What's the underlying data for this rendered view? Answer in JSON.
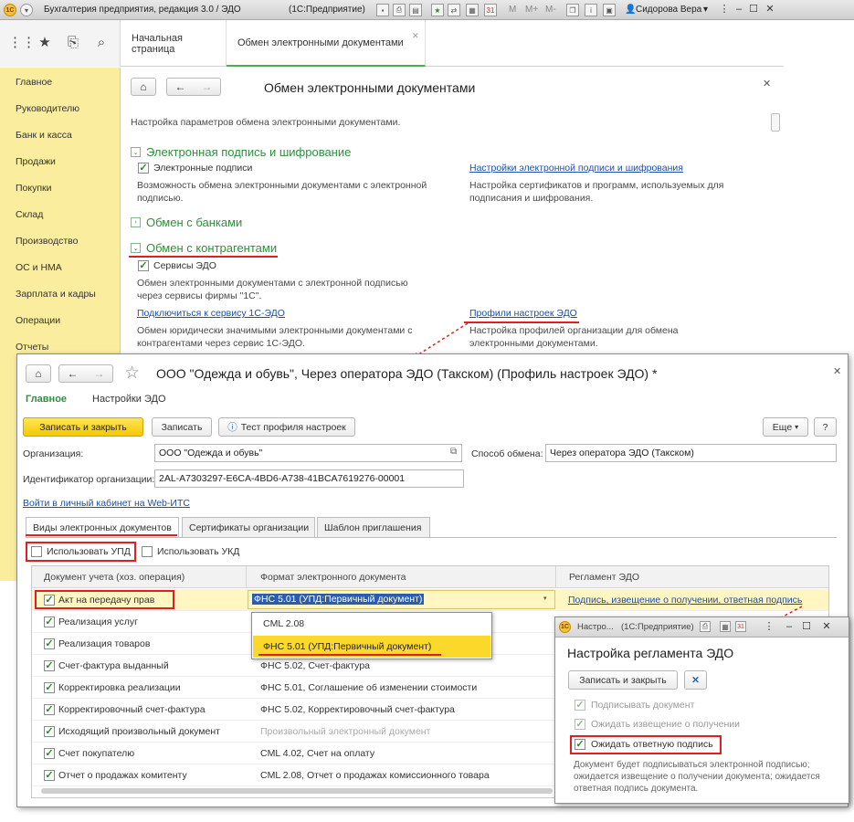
{
  "app": {
    "title": "Бухгалтерия предприятия, редакция 3.0 / ЭДО",
    "platform": "(1С:Предприятие)",
    "toolbar_letters": [
      "M",
      "M+",
      "M-"
    ],
    "user": "Сидорова Вера"
  },
  "tabs": [
    {
      "label": "Начальная страница"
    },
    {
      "label": "Обмен электронными документами"
    }
  ],
  "sidebar": {
    "items": [
      "Главное",
      "Руководителю",
      "Банк и касса",
      "Продажи",
      "Покупки",
      "Склад",
      "Производство",
      "ОС и НМА",
      "Зарплата и кадры",
      "Операции",
      "Отчеты"
    ]
  },
  "main": {
    "title": "Обмен электронными документами",
    "description": "Настройка параметров обмена электронными документами.",
    "section_signature": {
      "title": "Электронная подпись и шифрование",
      "checkbox": "Электронные подписи",
      "desc": "Возможность обмена электронными документами с электронной подписью.",
      "link": "Настройки электронной подписи и шифрования",
      "link_desc": "Настройка сертификатов и программ, используемых для подписания и шифрования."
    },
    "section_banks": {
      "title": "Обмен с банками"
    },
    "section_counterparties": {
      "title": "Обмен с контрагентами",
      "checkbox": "Сервисы ЭДО",
      "desc": "Обмен электронными документами с электронной подписью через сервисы фирмы \"1С\".",
      "link_connect": "Подключиться к сервису 1С-ЭДО",
      "link_connect_desc": "Обмен юридически значимыми электронными документами с контрагентами через сервис 1С-ЭДО.",
      "link_profiles": "Профили настроек ЭДО",
      "link_profiles_desc": "Настройка профилей организации для обмена электронными документами."
    }
  },
  "dialog": {
    "title": "ООО \"Одежда и обувь\", Через оператора ЭДО (Такском) (Профиль настроек ЭДО) *",
    "nav_main": "Главное",
    "nav_settings": "Настройки ЭДО",
    "btn_save_close": "Записать и закрыть",
    "btn_save": "Записать",
    "btn_test": "Тест профиля настроек",
    "btn_more": "Еще",
    "btn_help": "?",
    "org_label": "Организация:",
    "org_value": "ООО \"Одежда и обувь\"",
    "method_label": "Способ обмена:",
    "method_value": "Через оператора ЭДО (Такском)",
    "id_label": "Идентификатор организации:",
    "id_value": "2AL-A7303297-E6CA-4BD6-A738-41BCA7619276-00001",
    "link_its": "Войти в личный кабинет на Web-ИТС",
    "tabs": [
      "Виды электронных документов",
      "Сертификаты организации",
      "Шаблон приглашения"
    ],
    "cb_upd": "Использовать УПД",
    "cb_ukd": "Использовать УКД",
    "columns": [
      "Документ учета (хоз. операция)",
      "Формат электронного документа",
      "Регламент ЭДО"
    ],
    "rows": [
      {
        "doc": "Акт на передачу прав",
        "format": "ФНС 5.01 (УПД:Первичный документ)",
        "reg": "Подпись, извещение о получении, ответная подпись"
      },
      {
        "doc": "Реализация услуг",
        "format": "",
        "reg": ""
      },
      {
        "doc": "Реализация товаров",
        "format": "",
        "reg": ""
      },
      {
        "doc": "Счет-фактура выданный",
        "format": "ФНС 5.02, Счет-фактура",
        "reg": ""
      },
      {
        "doc": "Корректировка реализации",
        "format": "ФНС 5.01, Соглашение об изменении стоимости",
        "reg": ""
      },
      {
        "doc": "Корректировочный счет-фактура",
        "format": "ФНС 5.02, Корректировочный счет-фактура",
        "reg": ""
      },
      {
        "doc": "Исходящий произвольный документ",
        "format": "Произвольный электронный документ",
        "reg": ""
      },
      {
        "doc": "Счет покупателю",
        "format": "CML 4.02, Счет на оплату",
        "reg": ""
      },
      {
        "doc": "Отчет о продажах комитенту",
        "format": "CML 2.08, Отчет о продажах комиссионного товара",
        "reg": ""
      }
    ],
    "dropdown_options": [
      "CML 2.08",
      "ФНС 5.01 (УПД:Первичный документ)"
    ]
  },
  "small_dialog": {
    "title_short": "Настро...",
    "platform": "(1С:Предприятие)",
    "heading": "Настройка регламента ЭДО",
    "btn_save_close": "Записать и закрыть",
    "cb_sign": "Подписывать документ",
    "cb_notice": "Ожидать извещение о получении",
    "cb_reply": "Ожидать ответную подпись",
    "desc": "Документ будет подписываться электронной подписью; ожидается извещение о получении документа; ожидается ответная подпись документа."
  },
  "colors": {
    "sidebar_bg": "#fbed9e",
    "section_green": "#2f8f3c",
    "link_blue": "#1d4fa8",
    "primary_yellow": "#f5c800",
    "highlight_red": "#e02020"
  }
}
